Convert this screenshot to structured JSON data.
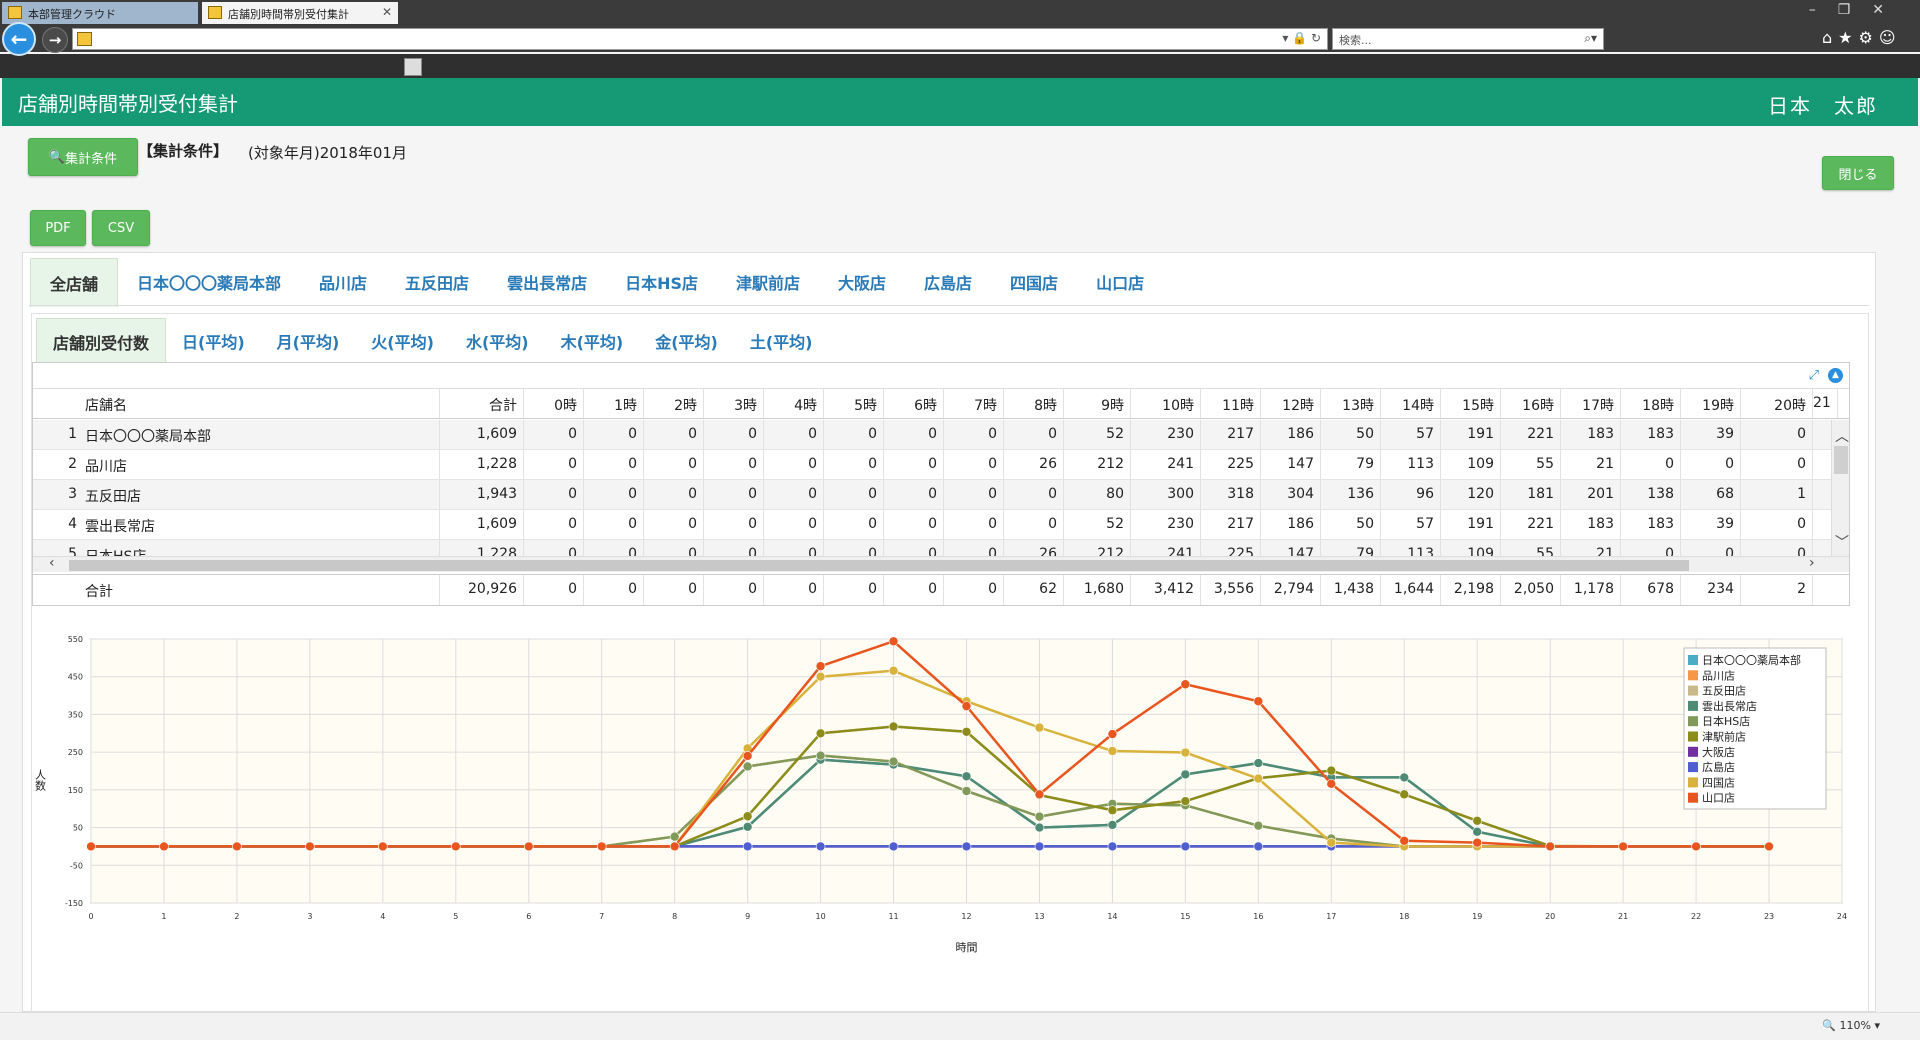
{
  "browser": {
    "tabs": [
      {
        "label": "本部管理クラウド"
      },
      {
        "label": "店舗別時間帯別受付集計"
      }
    ],
    "search_placeholder": "検索...",
    "zoom": "110%"
  },
  "header": {
    "title": "店舗別時間帯別受付集計",
    "user": "日本　太郎"
  },
  "toolbar": {
    "condition_button": "集計条件",
    "condition_heading": "【集計条件】",
    "condition_value": "(対象年月)2018年01月",
    "close_button": "閉じる",
    "pdf_button": "PDF",
    "csv_button": "CSV"
  },
  "store_tabs": [
    {
      "label": "全店舗",
      "active": true
    },
    {
      "label": "日本〇〇〇薬局本部"
    },
    {
      "label": "品川店"
    },
    {
      "label": "五反田店"
    },
    {
      "label": "雲出長常店"
    },
    {
      "label": "日本HS店"
    },
    {
      "label": "津駅前店"
    },
    {
      "label": "大阪店"
    },
    {
      "label": "広島店"
    },
    {
      "label": "四国店"
    },
    {
      "label": "山口店"
    }
  ],
  "view_tabs": [
    {
      "label": "店舗別受付数",
      "active": true
    },
    {
      "label": "日(平均)"
    },
    {
      "label": "月(平均)"
    },
    {
      "label": "火(平均)"
    },
    {
      "label": "水(平均)"
    },
    {
      "label": "木(平均)"
    },
    {
      "label": "金(平均)"
    },
    {
      "label": "土(平均)"
    }
  ],
  "grid": {
    "columns": [
      "店舗名",
      "合計",
      "0時",
      "1時",
      "2時",
      "3時",
      "4時",
      "5時",
      "6時",
      "7時",
      "8時",
      "9時",
      "10時",
      "11時",
      "12時",
      "13時",
      "14時",
      "15時",
      "16時",
      "17時",
      "18時",
      "19時",
      "20時",
      "21"
    ],
    "rows": [
      {
        "idx": "1",
        "name": "日本〇〇〇薬局本部",
        "values": [
          "1,609",
          "0",
          "0",
          "0",
          "0",
          "0",
          "0",
          "0",
          "0",
          "0",
          "52",
          "230",
          "217",
          "186",
          "50",
          "57",
          "191",
          "221",
          "183",
          "183",
          "39",
          "0"
        ]
      },
      {
        "idx": "2",
        "name": "品川店",
        "values": [
          "1,228",
          "0",
          "0",
          "0",
          "0",
          "0",
          "0",
          "0",
          "0",
          "26",
          "212",
          "241",
          "225",
          "147",
          "79",
          "113",
          "109",
          "55",
          "21",
          "0",
          "0",
          "0"
        ]
      },
      {
        "idx": "3",
        "name": "五反田店",
        "values": [
          "1,943",
          "0",
          "0",
          "0",
          "0",
          "0",
          "0",
          "0",
          "0",
          "0",
          "80",
          "300",
          "318",
          "304",
          "136",
          "96",
          "120",
          "181",
          "201",
          "138",
          "68",
          "1"
        ]
      },
      {
        "idx": "4",
        "name": "雲出長常店",
        "values": [
          "1,609",
          "0",
          "0",
          "0",
          "0",
          "0",
          "0",
          "0",
          "0",
          "0",
          "52",
          "230",
          "217",
          "186",
          "50",
          "57",
          "191",
          "221",
          "183",
          "183",
          "39",
          "0"
        ]
      },
      {
        "idx": "5",
        "name": "日本HS店",
        "values": [
          "1,228",
          "0",
          "0",
          "0",
          "0",
          "0",
          "0",
          "0",
          "0",
          "26",
          "212",
          "241",
          "225",
          "147",
          "79",
          "113",
          "109",
          "55",
          "21",
          "0",
          "0",
          "0"
        ]
      }
    ],
    "total": {
      "label": "合計",
      "values": [
        "20,926",
        "0",
        "0",
        "0",
        "0",
        "0",
        "0",
        "0",
        "0",
        "62",
        "1,680",
        "3,412",
        "3,556",
        "2,794",
        "1,438",
        "1,644",
        "2,198",
        "2,050",
        "1,178",
        "678",
        "234",
        "2"
      ]
    }
  },
  "chart_data": {
    "type": "line",
    "xlabel": "時間",
    "ylabel": "人数",
    "xlim": [
      0,
      24
    ],
    "ylim": [
      -150,
      550
    ],
    "x_ticks": [
      0,
      1,
      2,
      3,
      4,
      5,
      6,
      7,
      8,
      9,
      10,
      11,
      12,
      13,
      14,
      15,
      16,
      17,
      18,
      19,
      20,
      21,
      22,
      23,
      24
    ],
    "y_ticks": [
      550,
      450,
      350,
      250,
      150,
      50,
      -50,
      -150
    ],
    "legend_position": "top-right",
    "x": [
      0,
      1,
      2,
      3,
      4,
      5,
      6,
      7,
      8,
      9,
      10,
      11,
      12,
      13,
      14,
      15,
      16,
      17,
      18,
      19,
      20,
      21,
      22,
      23
    ],
    "series": [
      {
        "name": "日本〇〇〇薬局本部",
        "color": "#4bacc6",
        "values": [
          0,
          0,
          0,
          0,
          0,
          0,
          0,
          0,
          0,
          52,
          230,
          217,
          186,
          50,
          57,
          191,
          221,
          183,
          183,
          39,
          0,
          0,
          0,
          0
        ]
      },
      {
        "name": "品川店",
        "color": "#f79646",
        "values": [
          0,
          0,
          0,
          0,
          0,
          0,
          0,
          0,
          26,
          212,
          241,
          225,
          147,
          79,
          113,
          109,
          55,
          21,
          0,
          0,
          0,
          0,
          0,
          0
        ]
      },
      {
        "name": "五反田店",
        "color": "#c8b98a",
        "values": [
          0,
          0,
          0,
          0,
          0,
          0,
          0,
          0,
          0,
          80,
          300,
          318,
          304,
          136,
          96,
          120,
          181,
          201,
          138,
          68,
          1,
          0,
          0,
          0
        ]
      },
      {
        "name": "雲出長常店",
        "color": "#4f8a75",
        "values": [
          0,
          0,
          0,
          0,
          0,
          0,
          0,
          0,
          0,
          52,
          230,
          217,
          186,
          50,
          57,
          191,
          221,
          183,
          183,
          39,
          0,
          0,
          0,
          0
        ]
      },
      {
        "name": "日本HS店",
        "color": "#7f9a5a",
        "values": [
          0,
          0,
          0,
          0,
          0,
          0,
          0,
          0,
          26,
          212,
          241,
          225,
          147,
          79,
          113,
          109,
          55,
          21,
          0,
          0,
          0,
          0,
          0,
          0
        ]
      },
      {
        "name": "津駅前店",
        "color": "#8c8c1a",
        "values": [
          0,
          0,
          0,
          0,
          0,
          0,
          0,
          0,
          0,
          80,
          300,
          318,
          304,
          136,
          96,
          120,
          181,
          201,
          138,
          68,
          1,
          0,
          0,
          0
        ]
      },
      {
        "name": "大阪店",
        "color": "#7030a0",
        "values": [
          0,
          0,
          0,
          0,
          0,
          0,
          0,
          0,
          0,
          0,
          0,
          0,
          0,
          0,
          0,
          0,
          0,
          0,
          0,
          0,
          0,
          0,
          0,
          0
        ]
      },
      {
        "name": "広島店",
        "color": "#4f5fd0",
        "values": [
          0,
          0,
          0,
          0,
          0,
          0,
          0,
          0,
          0,
          0,
          0,
          0,
          0,
          0,
          0,
          0,
          0,
          0,
          0,
          0,
          0,
          0,
          0,
          0
        ]
      },
      {
        "name": "四国店",
        "color": "#d9b23c",
        "values": [
          0,
          0,
          0,
          0,
          0,
          0,
          0,
          0,
          0,
          260,
          450,
          466,
          385,
          315,
          253,
          249,
          180,
          10,
          0,
          0,
          0,
          0,
          0,
          0
        ]
      },
      {
        "name": "山口店",
        "color": "#e8551e",
        "values": [
          0,
          0,
          0,
          0,
          0,
          0,
          0,
          0,
          0,
          240,
          478,
          544,
          372,
          138,
          298,
          430,
          385,
          166,
          15,
          10,
          0,
          0,
          0,
          0
        ]
      }
    ]
  }
}
